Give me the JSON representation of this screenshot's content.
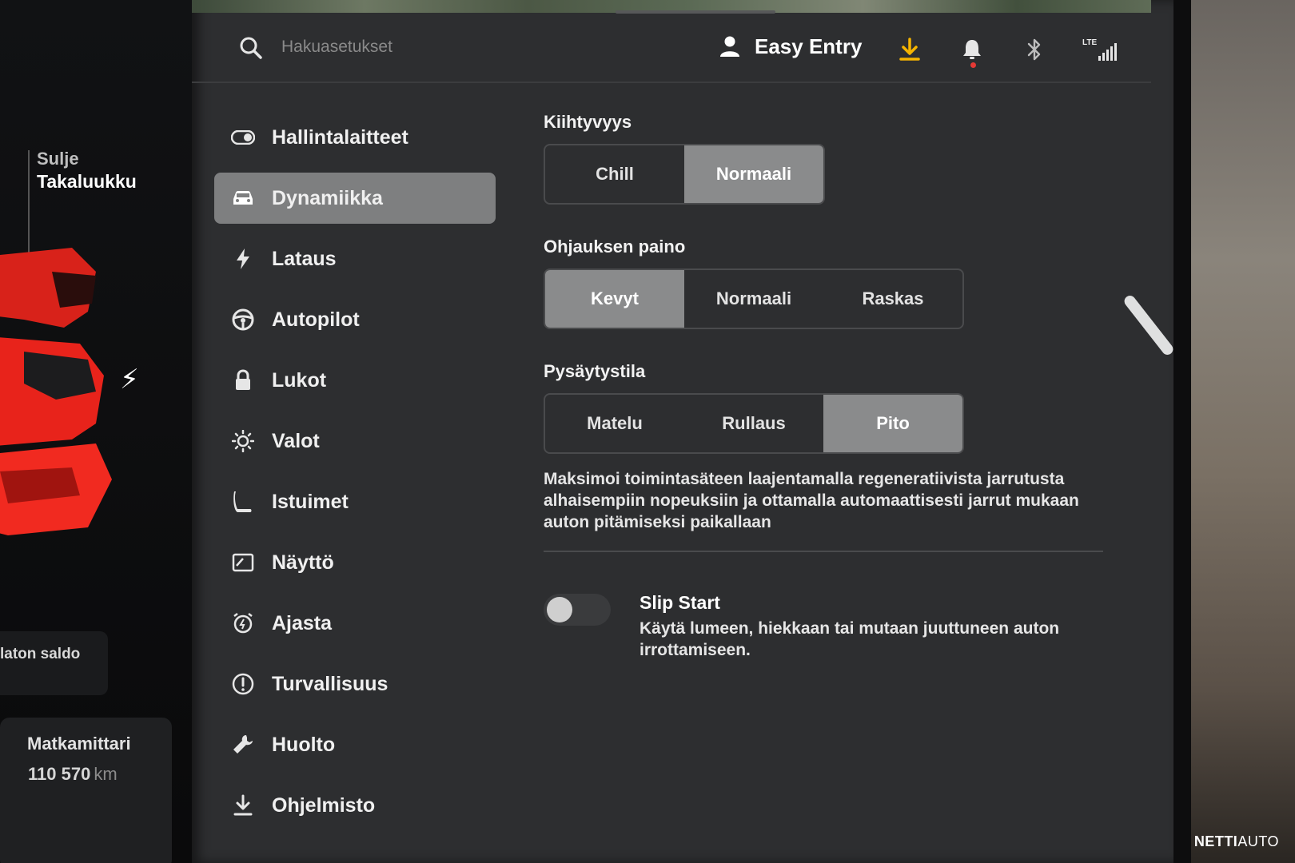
{
  "car_panel": {
    "trunk_label_line1": "Sulje",
    "trunk_label_line2": "Takaluukku",
    "balance_label": "laton saldo",
    "odometer_title": "Matkamittari",
    "odometer_value": "110 570",
    "odometer_unit": "km",
    "accent_color": "#e8231b"
  },
  "topbar": {
    "search_placeholder": "Hakuasetukset",
    "profile_name": "Easy Entry",
    "status_icons": [
      "download-icon",
      "bell-icon",
      "bluetooth-icon",
      "lte-signal-icon"
    ],
    "lte_label": "LTE",
    "download_color": "#f5b400"
  },
  "menu": {
    "items": [
      {
        "label": "Hallintalaitteet",
        "icon": "toggle-icon"
      },
      {
        "label": "Dynamiikka",
        "icon": "car-icon"
      },
      {
        "label": "Lataus",
        "icon": "bolt-icon"
      },
      {
        "label": "Autopilot",
        "icon": "steering-wheel-icon"
      },
      {
        "label": "Lukot",
        "icon": "lock-icon"
      },
      {
        "label": "Valot",
        "icon": "sun-icon"
      },
      {
        "label": "Istuimet",
        "icon": "seat-icon"
      },
      {
        "label": "Näyttö",
        "icon": "display-icon"
      },
      {
        "label": "Ajasta",
        "icon": "alarm-clock-icon"
      },
      {
        "label": "Turvallisuus",
        "icon": "warning-icon"
      },
      {
        "label": "Huolto",
        "icon": "wrench-icon"
      },
      {
        "label": "Ohjelmisto",
        "icon": "download-icon"
      }
    ],
    "active": "Dynamiikka"
  },
  "settings": {
    "acceleration": {
      "title": "Kiihtyvyys",
      "options": [
        "Chill",
        "Normaali"
      ],
      "selected": "Normaali"
    },
    "steering": {
      "title": "Ohjauksen paino",
      "options": [
        "Kevyt",
        "Normaali",
        "Raskas"
      ],
      "selected": "Kevyt"
    },
    "stopping": {
      "title": "Pysäytystila",
      "options": [
        "Matelu",
        "Rullaus",
        "Pito"
      ],
      "selected": "Pito",
      "description": "Maksimoi toimintasäteen laajentamalla regeneratiivista jarrutusta alhaisempiin nopeuksiin ja ottamalla automaattisesti jarrut mukaan auton pitämiseksi paikallaan"
    },
    "slip_start": {
      "title": "Slip Start",
      "description": "Käytä lumeen, hiekkaan tai mutaan juuttuneen auton irrottamiseen.",
      "enabled": false
    }
  },
  "watermark": {
    "brand_bold": "NETTI",
    "brand_light": "AUTO"
  }
}
